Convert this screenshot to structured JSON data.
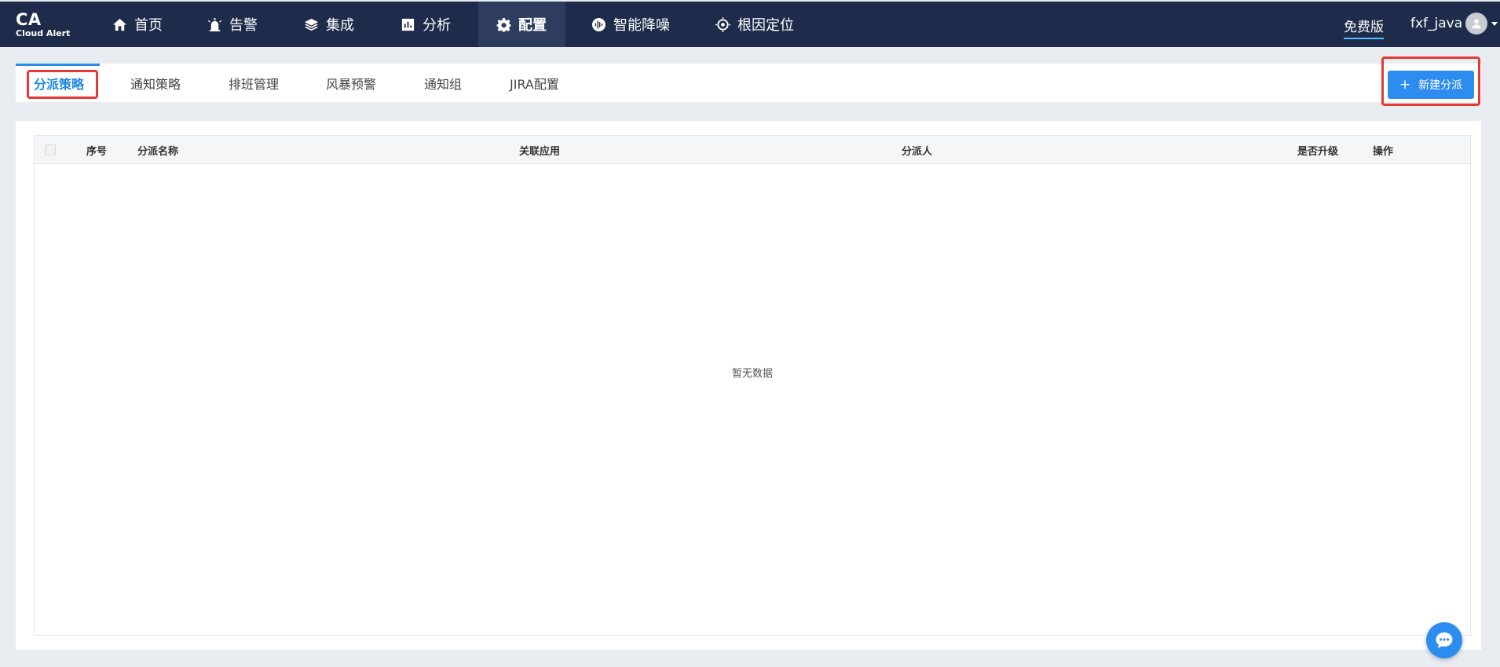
{
  "logo": {
    "title": "CA",
    "subtitle": "Cloud Alert"
  },
  "nav": {
    "items": [
      {
        "label": "首页",
        "icon": "home-icon"
      },
      {
        "label": "告警",
        "icon": "alarm-icon"
      },
      {
        "label": "集成",
        "icon": "layers-icon"
      },
      {
        "label": "分析",
        "icon": "chart-icon"
      },
      {
        "label": "配置",
        "icon": "gear-icon",
        "active": true
      },
      {
        "label": "智能降噪",
        "icon": "noise-icon"
      },
      {
        "label": "根因定位",
        "icon": "target-icon"
      }
    ],
    "free_version": "免费版",
    "username": "fxf_java"
  },
  "tabs": {
    "items": [
      {
        "label": "分派策略",
        "active": true
      },
      {
        "label": "通知策略"
      },
      {
        "label": "排班管理"
      },
      {
        "label": "风暴预警"
      },
      {
        "label": "通知组"
      },
      {
        "label": "JIRA配置"
      }
    ],
    "new_button": "新建分派"
  },
  "table": {
    "columns": [
      "序号",
      "分派名称",
      "关联应用",
      "分派人",
      "是否升级",
      "操作"
    ],
    "empty_text": "暂无数据"
  },
  "colors": {
    "nav_bg": "#1e2b4a",
    "accent": "#2d8cf0",
    "highlight": "#e53935"
  }
}
